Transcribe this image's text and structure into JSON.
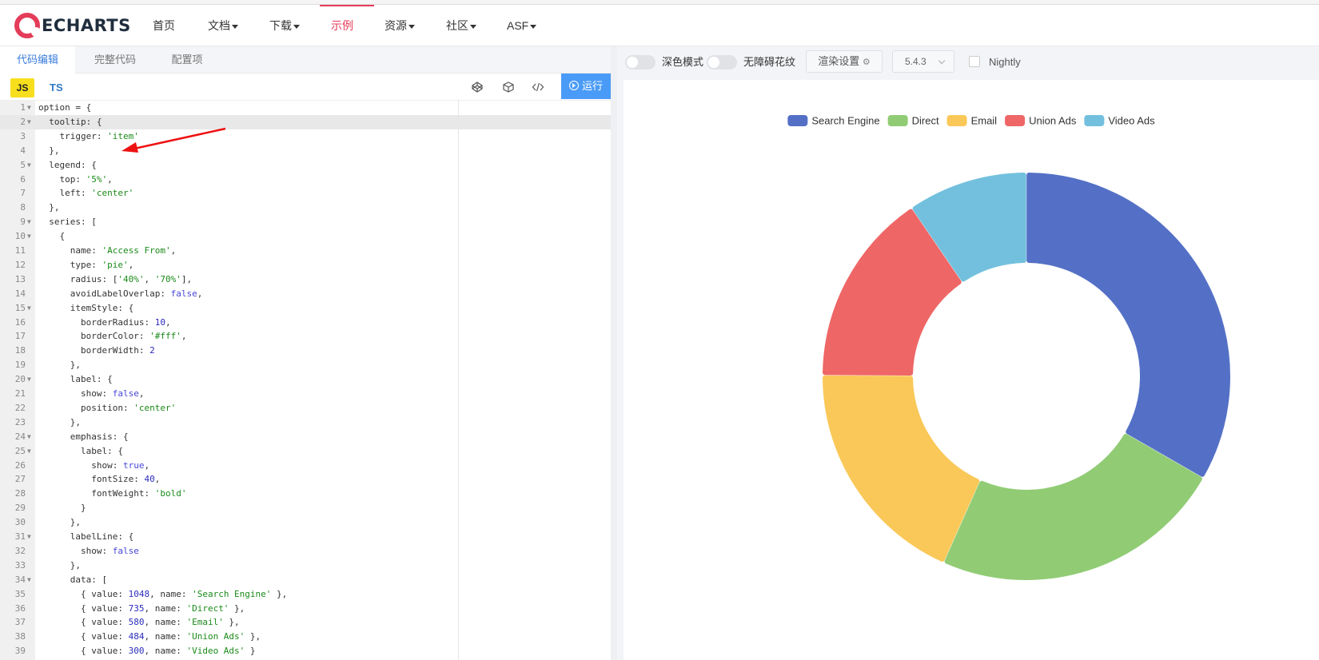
{
  "brand": {
    "logo_text": "ECHARTS",
    "accent": "#e43c59"
  },
  "nav": {
    "items": [
      {
        "label": "首页",
        "dropdown": false
      },
      {
        "label": "文档",
        "dropdown": true
      },
      {
        "label": "下载",
        "dropdown": true
      },
      {
        "label": "示例",
        "dropdown": false,
        "active": true
      },
      {
        "label": "资源",
        "dropdown": true
      },
      {
        "label": "社区",
        "dropdown": true
      },
      {
        "label": "ASF",
        "dropdown": true
      }
    ]
  },
  "editor": {
    "tabs": [
      {
        "label": "代码编辑",
        "active": true
      },
      {
        "label": "完整代码",
        "active": false
      },
      {
        "label": "配置项",
        "active": false
      }
    ],
    "lang_js": "JS",
    "lang_ts": "TS",
    "tool_icons": [
      "codepen-icon",
      "codesandbox-icon",
      "code-icon"
    ],
    "run_label": "运行",
    "active_line": 2,
    "lines": [
      {
        "n": "1",
        "fold": true,
        "src": "option = {"
      },
      {
        "n": "2",
        "fold": true,
        "src": "  tooltip: {"
      },
      {
        "n": "3",
        "fold": false,
        "src": "    trigger: 'item'"
      },
      {
        "n": "4",
        "fold": false,
        "src": "  },"
      },
      {
        "n": "5",
        "fold": true,
        "src": "  legend: {"
      },
      {
        "n": "6",
        "fold": false,
        "src": "    top: '5%',"
      },
      {
        "n": "7",
        "fold": false,
        "src": "    left: 'center'"
      },
      {
        "n": "8",
        "fold": false,
        "src": "  },"
      },
      {
        "n": "9",
        "fold": true,
        "src": "  series: ["
      },
      {
        "n": "10",
        "fold": true,
        "src": "    {"
      },
      {
        "n": "11",
        "fold": false,
        "src": "      name: 'Access From',"
      },
      {
        "n": "12",
        "fold": false,
        "src": "      type: 'pie',"
      },
      {
        "n": "13",
        "fold": false,
        "src": "      radius: ['40%', '70%'],"
      },
      {
        "n": "14",
        "fold": false,
        "src": "      avoidLabelOverlap: false,"
      },
      {
        "n": "15",
        "fold": true,
        "src": "      itemStyle: {"
      },
      {
        "n": "16",
        "fold": false,
        "src": "        borderRadius: 10,"
      },
      {
        "n": "17",
        "fold": false,
        "src": "        borderColor: '#fff',"
      },
      {
        "n": "18",
        "fold": false,
        "src": "        borderWidth: 2"
      },
      {
        "n": "19",
        "fold": false,
        "src": "      },"
      },
      {
        "n": "20",
        "fold": true,
        "src": "      label: {"
      },
      {
        "n": "21",
        "fold": false,
        "src": "        show: false,"
      },
      {
        "n": "22",
        "fold": false,
        "src": "        position: 'center'"
      },
      {
        "n": "23",
        "fold": false,
        "src": "      },"
      },
      {
        "n": "24",
        "fold": true,
        "src": "      emphasis: {"
      },
      {
        "n": "25",
        "fold": true,
        "src": "        label: {"
      },
      {
        "n": "26",
        "fold": false,
        "src": "          show: true,"
      },
      {
        "n": "27",
        "fold": false,
        "src": "          fontSize: 40,"
      },
      {
        "n": "28",
        "fold": false,
        "src": "          fontWeight: 'bold'"
      },
      {
        "n": "29",
        "fold": false,
        "src": "        }"
      },
      {
        "n": "30",
        "fold": false,
        "src": "      },"
      },
      {
        "n": "31",
        "fold": true,
        "src": "      labelLine: {"
      },
      {
        "n": "32",
        "fold": false,
        "src": "        show: false"
      },
      {
        "n": "33",
        "fold": false,
        "src": "      },"
      },
      {
        "n": "34",
        "fold": true,
        "src": "      data: ["
      },
      {
        "n": "35",
        "fold": false,
        "src": "        { value: 1048, name: 'Search Engine' },"
      },
      {
        "n": "36",
        "fold": false,
        "src": "        { value: 735, name: 'Direct' },"
      },
      {
        "n": "37",
        "fold": false,
        "src": "        { value: 580, name: 'Email' },"
      },
      {
        "n": "38",
        "fold": false,
        "src": "        { value: 484, name: 'Union Ads' },"
      },
      {
        "n": "39",
        "fold": false,
        "src": "        { value: 300, name: 'Video Ads' }"
      }
    ]
  },
  "preview_controls": {
    "dark_mode_label": "深色模式",
    "a11y_pattern_label": "无障碍花纹",
    "render_settings_label": "渲染设置",
    "version": "5.4.3",
    "nightly_label": "Nightly"
  },
  "chart_data": {
    "type": "pie",
    "donut": true,
    "series_name": "Access From",
    "legend_position": "top-center",
    "categories": [
      "Search Engine",
      "Direct",
      "Email",
      "Union Ads",
      "Video Ads"
    ],
    "values": [
      1048,
      735,
      580,
      484,
      300
    ],
    "colors": [
      "#5470c6",
      "#91cc75",
      "#fac858",
      "#ee6666",
      "#73c0de"
    ]
  }
}
